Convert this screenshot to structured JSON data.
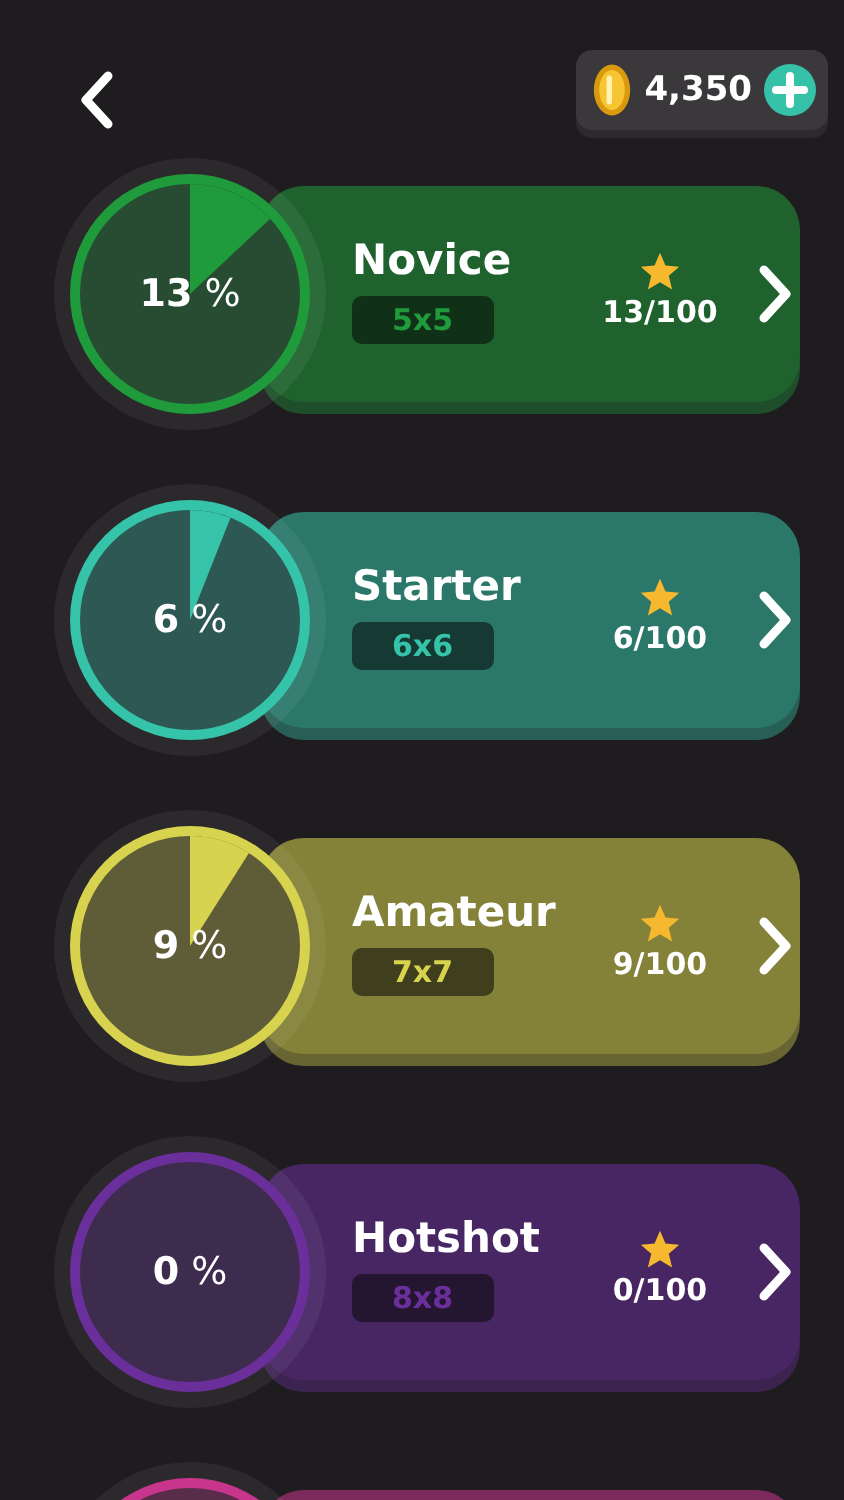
{
  "header": {
    "coins": "4,350"
  },
  "levels": [
    {
      "name": "Novice",
      "size": "5x5",
      "percent": "**13** %",
      "level": 0.13,
      "stars": "13/100",
      "color": "#1f9b3b"
    },
    {
      "name": "Starter",
      "size": "6x6",
      "percent": "**6** %",
      "level": 0.06,
      "stars": "6/100",
      "color": "#35c4a9"
    },
    {
      "name": "Amateur",
      "size": "7x7",
      "percent": "**9** %",
      "level": 0.09,
      "stars": "9/100",
      "color": "#d8d34f"
    },
    {
      "name": "Hotshot",
      "size": "8x8",
      "percent": "**0** %",
      "level": 0,
      "stars": "0/100",
      "color": "#6b2f9c"
    }
  ],
  "next_level_peek": {
    "color": "#c8358c"
  }
}
